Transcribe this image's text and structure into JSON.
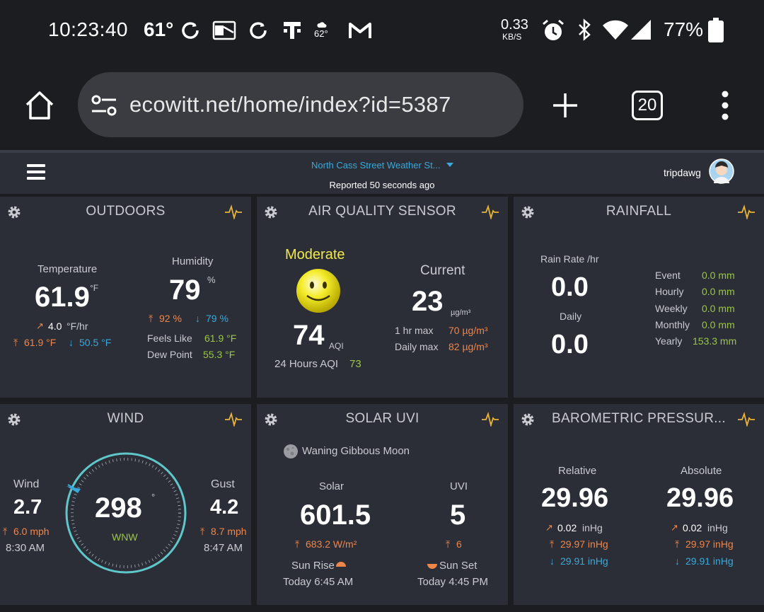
{
  "status_bar": {
    "time": "10:23:40",
    "temp": "61°",
    "weather_small": "62°",
    "net_speed_value": "0.33",
    "net_speed_unit": "KB/S",
    "battery": "77%"
  },
  "browser": {
    "url": "ecowitt.net/home/index?id=5387",
    "tab_count": "20"
  },
  "header": {
    "station_name": "North Cass Street Weather St...",
    "reported": "Reported 50 seconds ago",
    "username": "tripdawg"
  },
  "outdoors": {
    "title": "OUTDOORS",
    "temp_label": "Temperature",
    "temp_value": "61.9",
    "temp_unit": "°F",
    "temp_rate_value": "4.0",
    "temp_rate_unit": "°F/hr",
    "temp_high": "61.9 °F",
    "temp_low": "50.5 °F",
    "humidity_label": "Humidity",
    "humidity_value": "79",
    "humidity_unit": "%",
    "humidity_high": "92 %",
    "humidity_low": "79 %",
    "feels_like_label": "Feels Like",
    "feels_like_value": "61.9 °F",
    "dew_point_label": "Dew Point",
    "dew_point_value": "55.3 °F"
  },
  "air_quality": {
    "title": "AIR QUALITY SENSOR",
    "status": "Moderate",
    "aqi_value": "74",
    "aqi_unit": "AQI",
    "aqi_24h_label": "24 Hours AQI",
    "aqi_24h_value": "73",
    "current_label": "Current",
    "current_value": "23",
    "current_unit": "µg/m³",
    "max_1hr_label": "1 hr max",
    "max_1hr_value": "70 µg/m³",
    "daily_max_label": "Daily max",
    "daily_max_value": "82 µg/m³"
  },
  "rainfall": {
    "title": "RAINFALL",
    "rate_label": "Rain Rate /hr",
    "rate_value": "0.0",
    "daily_label": "Daily",
    "daily_value": "0.0",
    "rows": [
      {
        "label": "Event",
        "value": "0.0 mm"
      },
      {
        "label": "Hourly",
        "value": "0.0 mm"
      },
      {
        "label": "Weekly",
        "value": "0.0 mm"
      },
      {
        "label": "Monthly",
        "value": "0.0 mm"
      },
      {
        "label": "Yearly",
        "value": "153.3 mm"
      }
    ]
  },
  "wind": {
    "title": "WIND",
    "wind_label": "Wind",
    "wind_value": "2.7",
    "wind_max": "6.0 mph",
    "wind_time": "8:30 AM",
    "direction_deg": "298",
    "direction_unit": "°",
    "direction_name": "WNW",
    "gust_label": "Gust",
    "gust_value": "4.2",
    "gust_max": "8.7 mph",
    "gust_time": "8:47 AM"
  },
  "solar_uvi": {
    "title": "SOLAR UVI",
    "moon": "Waning Gibbous Moon",
    "solar_label": "Solar",
    "solar_value": "601.5",
    "solar_max": "683.2 W/m²",
    "uvi_label": "UVI",
    "uvi_value": "5",
    "uvi_max": "6",
    "sunrise_label": "Sun Rise",
    "sunrise_time": "Today 6:45 AM",
    "sunset_label": "Sun Set",
    "sunset_time": "Today 4:45 PM"
  },
  "pressure": {
    "title": "BAROMETRIC PRESSUR...",
    "relative_label": "Relative",
    "relative_value": "29.96",
    "relative_rate": "0.02",
    "relative_high": "29.97 inHg",
    "relative_low": "29.91 inHg",
    "absolute_label": "Absolute",
    "absolute_value": "29.96",
    "absolute_rate": "0.02",
    "absolute_high": "29.97 inHg",
    "absolute_low": "29.91 inHg",
    "rate_unit": "inHg"
  },
  "colors": {
    "accent_blue": "#3aa9d9",
    "high_orange": "#f0854a",
    "value_green": "#9ac54a",
    "aqi_yellow": "#f2e84a"
  }
}
